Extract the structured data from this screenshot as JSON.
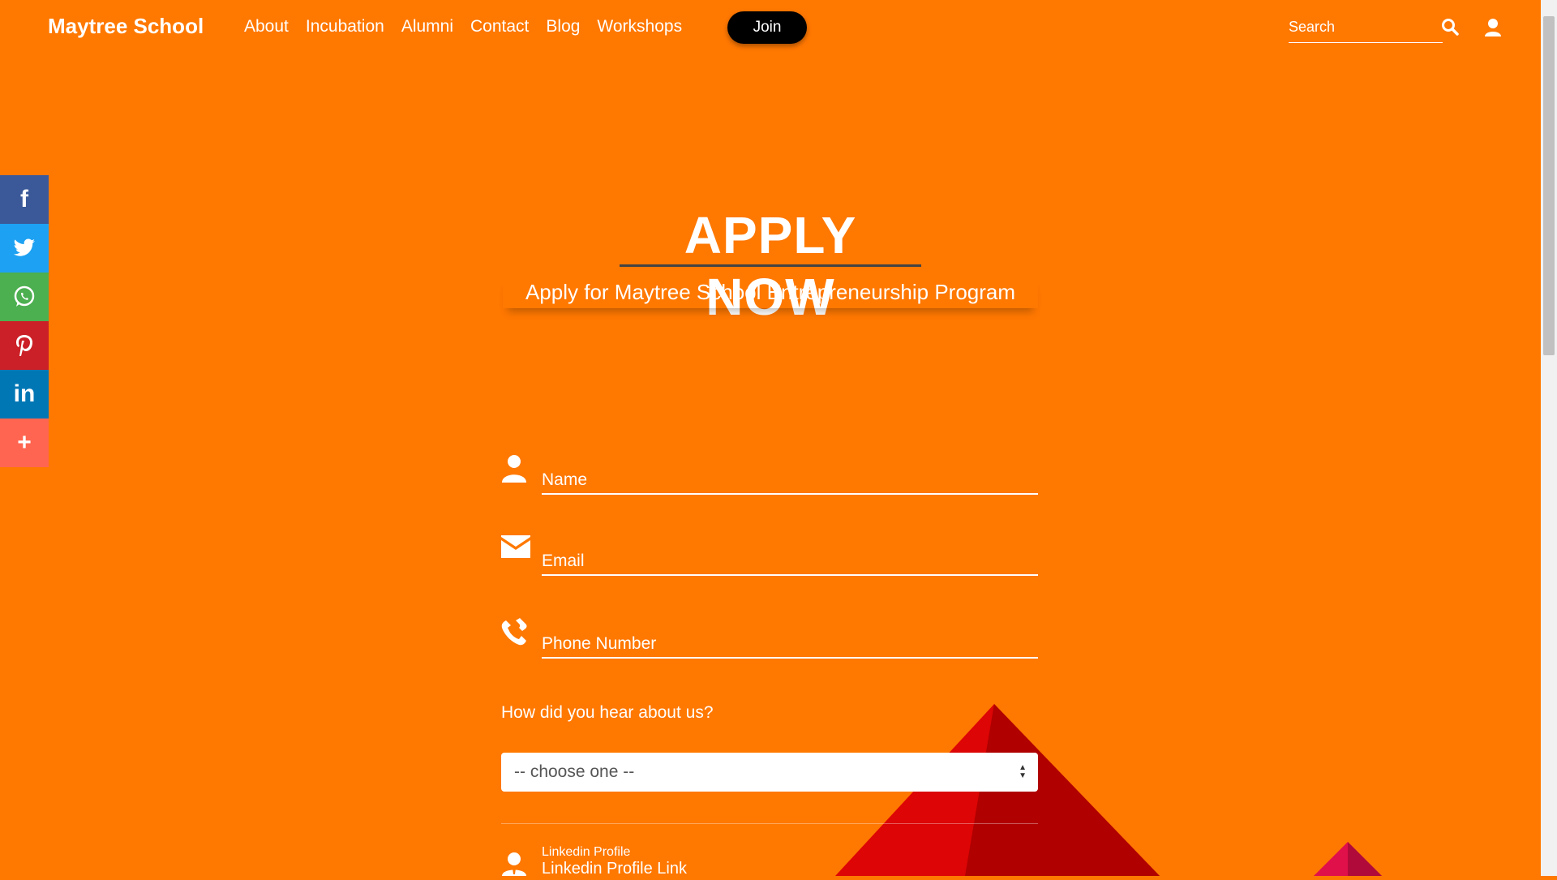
{
  "nav": {
    "brand": "Maytree School",
    "links": [
      "About",
      "Incubation",
      "Alumni",
      "Contact",
      "Blog",
      "Workshops"
    ],
    "join_label": "Join",
    "search_placeholder": "Search"
  },
  "social": {
    "items": [
      "facebook-icon",
      "twitter-icon",
      "whatsapp-icon",
      "pinterest-icon",
      "linkedin-icon",
      "more-icon"
    ],
    "colors": {
      "facebook": "#3b5998",
      "twitter": "#1da1f2",
      "whatsapp": "#4caf50",
      "pinterest": "#cb2027",
      "linkedin": "#0077b5",
      "more": "#ff6550"
    }
  },
  "hero": {
    "title": "APPLY NOW",
    "subtitle": "Apply for Maytree School Entrepreneurship Program"
  },
  "form": {
    "name_label": "Name",
    "email_label": "Email",
    "phone_label": "Phone Number",
    "hear_label": "How did you hear about us?",
    "hear_selected": "-- choose one --",
    "linkedin_small_label": "Linkedin Profile",
    "linkedin_placeholder": "Linkedin Profile Link"
  },
  "colors": {
    "background": "#ff7800",
    "join_button": "#000000",
    "triangle_light": "#e00000",
    "triangle_dark": "#b30000",
    "triangle_pink": "#e0104a"
  }
}
